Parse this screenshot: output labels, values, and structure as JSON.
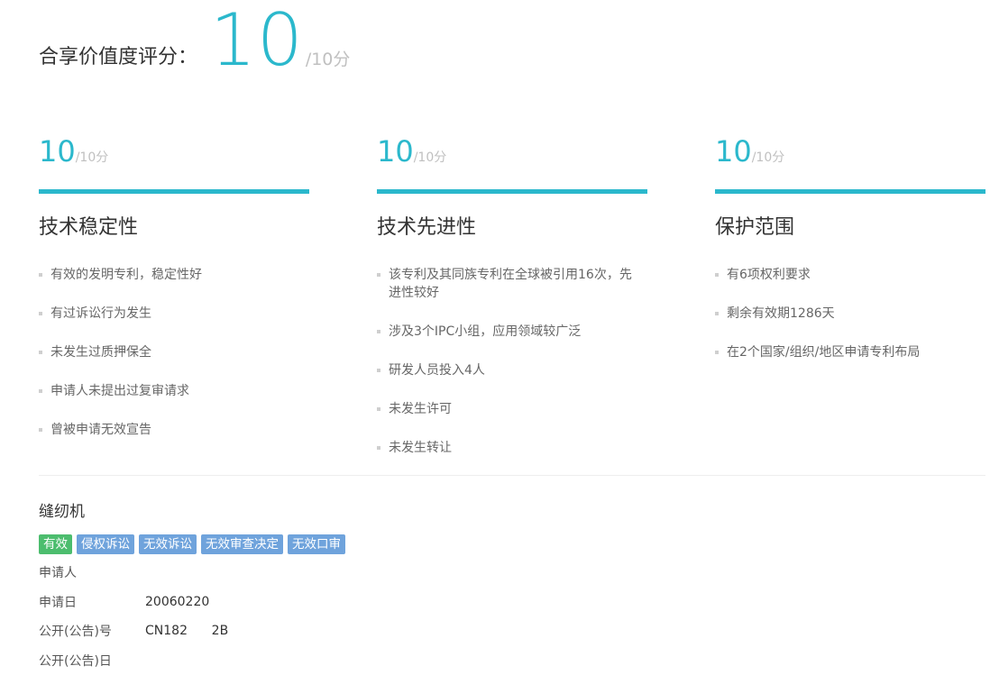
{
  "overall": {
    "label": "合享价值度评分：",
    "score": "10",
    "max": "/10分"
  },
  "columns": [
    {
      "score": "10",
      "max": "/10分",
      "title": "技术稳定性",
      "items": [
        "有效的发明专利，稳定性好",
        "有过诉讼行为发生",
        "未发生过质押保全",
        "申请人未提出过复审请求",
        "曾被申请无效宣告"
      ]
    },
    {
      "score": "10",
      "max": "/10分",
      "title": "技术先进性",
      "items": [
        "该专利及其同族专利在全球被引用16次，先进性较好",
        "涉及3个IPC小组，应用领域较广泛",
        "研发人员投入4人",
        "未发生许可",
        "未发生转让"
      ]
    },
    {
      "score": "10",
      "max": "/10分",
      "title": "保护范围",
      "items": [
        "有6项权利要求",
        "剩余有效期1286天",
        "在2个国家/组织/地区申请专利布局"
      ]
    }
  ],
  "patent": {
    "title": "缝纫机",
    "tags": [
      {
        "label": "有效",
        "color": "#4cbd6e"
      },
      {
        "label": "侵权诉讼",
        "color": "#6fa3dc"
      },
      {
        "label": "无效诉讼",
        "color": "#6fa3dc"
      },
      {
        "label": "无效审查决定",
        "color": "#6fa3dc"
      },
      {
        "label": "无效口审",
        "color": "#6fa3dc"
      }
    ],
    "info": [
      {
        "key": "申请人",
        "value": ""
      },
      {
        "key": "申请日",
        "value": "20060220"
      },
      {
        "key": "公开(公告)号",
        "value": "CN182      2B"
      },
      {
        "key": "公开(公告)日",
        "value": ""
      }
    ]
  },
  "colors": {
    "accent": "#2bb8cc",
    "muted": "#c0c0c0"
  }
}
